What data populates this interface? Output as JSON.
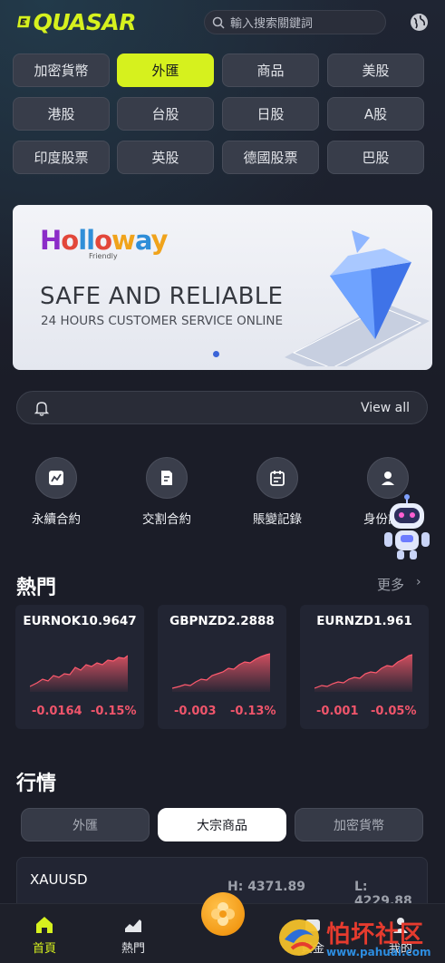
{
  "header": {
    "logo_text": "QUASAR",
    "search_placeholder": "輸入搜索關鍵詞"
  },
  "categories": [
    {
      "label": "加密貨幣",
      "active": false
    },
    {
      "label": "外匯",
      "active": true
    },
    {
      "label": "商品",
      "active": false
    },
    {
      "label": "美股",
      "active": false
    },
    {
      "label": "港股",
      "active": false
    },
    {
      "label": "台股",
      "active": false
    },
    {
      "label": "日股",
      "active": false
    },
    {
      "label": "A股",
      "active": false
    },
    {
      "label": "印度股票",
      "active": false
    },
    {
      "label": "英股",
      "active": false
    },
    {
      "label": "德國股票",
      "active": false
    },
    {
      "label": "巴股",
      "active": false
    }
  ],
  "banner": {
    "brand": "Holloway",
    "brand_sub": "Friendly",
    "title": "SAFE AND RELIABLE",
    "subtitle": "24 HOURS CUSTOMER SERVICE ONLINE"
  },
  "notice": {
    "view_all": "View all"
  },
  "quick_actions": [
    {
      "label": "永續合約",
      "icon": "chart-icon"
    },
    {
      "label": "交割合約",
      "icon": "document-icon"
    },
    {
      "label": "賬變記錄",
      "icon": "calendar-icon"
    },
    {
      "label": "身份認證",
      "icon": "user-check-icon"
    }
  ],
  "hot": {
    "title": "熱門",
    "more": "更多",
    "items": [
      {
        "symbol": "EURNOK10.9647",
        "change": "-0.0164",
        "percent": "-0.15%"
      },
      {
        "symbol": "GBPNZD2.2888",
        "change": "-0.003",
        "percent": "-0.13%"
      },
      {
        "symbol": "EURNZD1.961",
        "change": "-0.001",
        "percent": "-0.05%"
      }
    ]
  },
  "market": {
    "title": "行情",
    "tabs": [
      {
        "label": "外匯",
        "active": false
      },
      {
        "label": "大宗商品",
        "active": true
      },
      {
        "label": "加密貨幣",
        "active": false
      }
    ],
    "quote": {
      "symbol": "XAUUSD",
      "high": "H: 4371.89",
      "low": "L: 4229.88"
    }
  },
  "bottom_nav": [
    {
      "label": "首頁",
      "active": true
    },
    {
      "label": "熱門",
      "active": false
    },
    {
      "label": "資金",
      "active": false
    },
    {
      "label": "我的",
      "active": false
    }
  ],
  "watermark": {
    "text": "怕坏社区",
    "url": "www.pahuai.com"
  },
  "colors": {
    "accent": "#d6f11e",
    "down": "#f0556b",
    "background": "#1b1d28"
  }
}
